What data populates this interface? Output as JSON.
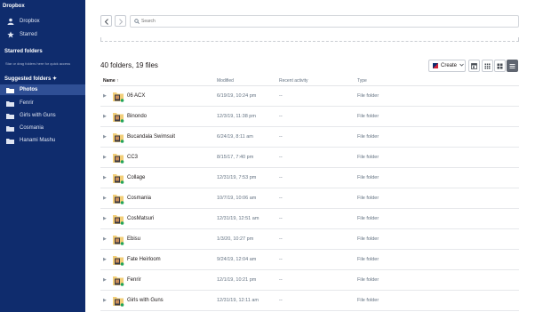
{
  "sidebar": {
    "title": "Dropbox",
    "nav": [
      {
        "label": "Dropbox",
        "icon": "person-icon"
      },
      {
        "label": "Starred",
        "icon": "star-icon"
      }
    ],
    "starred_heading": "Starred folders",
    "starred_hint": "Star or drag folders here for quick access",
    "suggested_heading": "Suggested folders",
    "suggested": [
      {
        "label": "Photos",
        "active": true
      },
      {
        "label": "Fenrir"
      },
      {
        "label": "Girls with Guns"
      },
      {
        "label": "Cosmania"
      },
      {
        "label": "Hanami Mashu"
      }
    ]
  },
  "toolbar": {
    "search_placeholder": "Search",
    "count": "40 folders, 19 files",
    "create_label": "Create"
  },
  "columns": {
    "name": "Name",
    "modified": "Modified",
    "activity": "Recent activity",
    "type": "Type"
  },
  "rows": [
    {
      "name": "06 ACX",
      "modified": "6/19/19, 10:24 pm",
      "activity": "--",
      "type": "File folder"
    },
    {
      "name": "Binondo",
      "modified": "12/3/19, 11:38 pm",
      "activity": "--",
      "type": "File folder"
    },
    {
      "name": "Bucandala Swimsuit",
      "modified": "6/24/19, 8:11 am",
      "activity": "--",
      "type": "File folder"
    },
    {
      "name": "CC3",
      "modified": "8/15/17, 7:40 pm",
      "activity": "--",
      "type": "File folder"
    },
    {
      "name": "Collage",
      "modified": "12/31/19, 7:53 pm",
      "activity": "--",
      "type": "File folder"
    },
    {
      "name": "Cosmania",
      "modified": "10/7/19, 10:06 am",
      "activity": "--",
      "type": "File folder"
    },
    {
      "name": "CosMatsuri",
      "modified": "12/31/19, 12:51 am",
      "activity": "--",
      "type": "File folder"
    },
    {
      "name": "Ebisu",
      "modified": "1/3/20, 10:27 pm",
      "activity": "--",
      "type": "File folder"
    },
    {
      "name": "Fate Heirloom",
      "modified": "9/24/19, 12:04 am",
      "activity": "--",
      "type": "File folder"
    },
    {
      "name": "Fenrir",
      "modified": "12/1/19, 10:21 pm",
      "activity": "--",
      "type": "File folder"
    },
    {
      "name": "Girls with Guns",
      "modified": "12/31/19, 12:11 am",
      "activity": "--",
      "type": "File folder"
    }
  ],
  "colors": {
    "sidebar_bg": "#0f2c6d",
    "sidebar_active": "#2f4f95",
    "folder": "#f2cf7a",
    "sync_badge": "#22a45a"
  }
}
